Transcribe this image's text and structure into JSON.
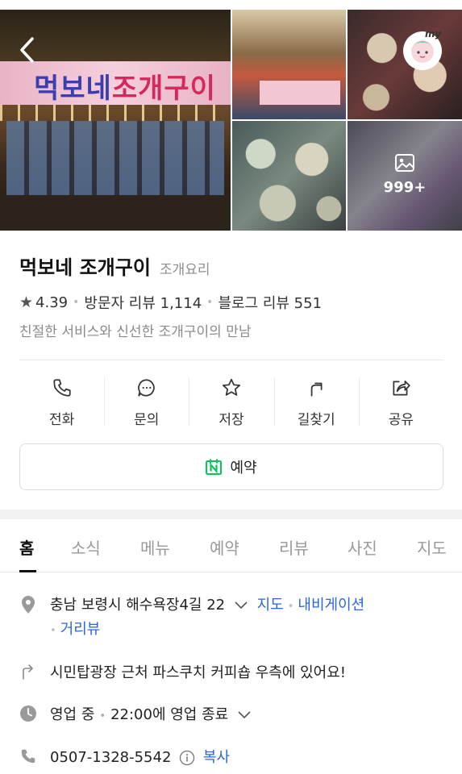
{
  "gallery": {
    "main_sign_text_part1": "먹보네",
    "main_sign_text_part2": "조개구이",
    "more_count": "999+"
  },
  "place": {
    "name": "먹보네 조개구이",
    "category": "조개요리",
    "rating": "4.39",
    "visitor_reviews": "방문자 리뷰 1,114",
    "blog_reviews": "블로그 리뷰 551",
    "description": "친절한 서비스와 신선한 조개구이의 만남"
  },
  "actions": [
    {
      "label": "전화",
      "icon": "phone-icon"
    },
    {
      "label": "문의",
      "icon": "chat-icon"
    },
    {
      "label": "저장",
      "icon": "star-icon"
    },
    {
      "label": "길찾기",
      "icon": "directions-icon"
    },
    {
      "label": "공유",
      "icon": "share-icon"
    }
  ],
  "reserve_button": {
    "label": "예약",
    "icon": "naver-booking-icon"
  },
  "tabs": [
    "홈",
    "소식",
    "메뉴",
    "예약",
    "리뷰",
    "사진",
    "지도"
  ],
  "active_tab": "홈",
  "details": {
    "address": "충남 보령시 해수욕장4길 22",
    "map_link": "지도",
    "navi_link": "내비게이션",
    "street_view_link": "거리뷰",
    "directions_text": "시민탑광장 근처 파스쿠치 커피숍 우측에 있어요!",
    "hours_status": "영업 중",
    "hours_close": "22:00에 영업 종료",
    "phone": "0507-1328-5542",
    "copy_label": "복사"
  },
  "colors": {
    "link": "#2d66d8",
    "naver_green": "#03c75a",
    "muted": "#8e8e8e"
  }
}
